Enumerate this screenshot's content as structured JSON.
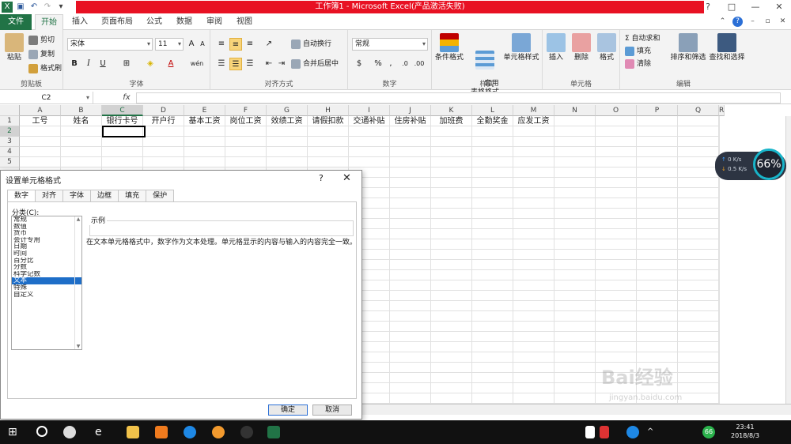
{
  "titlebar": {
    "title": "工作簿1 - Microsoft Excel(产品激活失败)",
    "window_buttons": [
      "?",
      "□",
      "—",
      "✕"
    ]
  },
  "tabs": [
    "文件",
    "开始",
    "插入",
    "页面布局",
    "公式",
    "数据",
    "审阅",
    "视图"
  ],
  "ribbon": {
    "clipboard": {
      "paste": "粘贴",
      "cut": "剪切",
      "copy": "复制",
      "painter": "格式刷",
      "label": "剪贴板"
    },
    "font": {
      "name": "宋体",
      "size": "11",
      "bold": "B",
      "italic": "I",
      "underline": "U",
      "phonetic": "wén",
      "label": "字体"
    },
    "align": {
      "wrap": "自动换行",
      "merge": "合并后居中",
      "label": "对齐方式"
    },
    "number": {
      "format": "常规",
      "percent": "%",
      "comma": ",",
      "label": "数字"
    },
    "styles": {
      "cond": "条件格式",
      "table": "套用\n表格格式",
      "cell": "单元格样式",
      "label": "样式"
    },
    "cells": {
      "insert": "插入",
      "delete": "删除",
      "format": "格式",
      "label": "单元格"
    },
    "edit": {
      "autosum": "Σ 自动求和",
      "fill": "填充",
      "clear": "清除",
      "sort": "排序和筛选",
      "find": "查找和选择",
      "label": "编辑"
    }
  },
  "formulabar": {
    "namebox": "C2",
    "fx": "fx",
    "value": ""
  },
  "grid": {
    "columns": [
      "A",
      "B",
      "C",
      "D",
      "E",
      "F",
      "G",
      "H",
      "I",
      "J",
      "K",
      "L",
      "M",
      "N",
      "O",
      "P",
      "Q",
      "R"
    ],
    "rows": [
      "1",
      "2",
      "3",
      "4",
      "5"
    ],
    "row1": [
      "工号",
      "姓名",
      "银行卡号",
      "开户行",
      "基本工资",
      "岗位工资",
      "效绩工资",
      "请假扣款",
      "交通补贴",
      "住房补贴",
      "加班费",
      "全勤奖金",
      "应发工资"
    ]
  },
  "netwidget": {
    "up": "0 K/s",
    "down": "0.5 K/s",
    "percent": "66%"
  },
  "dialog": {
    "title": "设置单元格格式",
    "help": "?",
    "close": "✕",
    "tabs": [
      "数字",
      "对齐",
      "字体",
      "边框",
      "填充",
      "保护"
    ],
    "category_label": "分类(C):",
    "categories": [
      "常规",
      "数值",
      "货币",
      "会计专用",
      "日期",
      "时间",
      "百分比",
      "分数",
      "科学记数",
      "文本",
      "特殊",
      "自定义"
    ],
    "selected_category": "文本",
    "sample_label": "示例",
    "description": "在文本单元格格式中，数字作为文本处理。单元格显示的内容与输入的内容完全一致。",
    "ok": "确定",
    "cancel": "取消"
  },
  "taskbar": {
    "time": "23:41",
    "date": "2018/8/3",
    "badge": "66"
  },
  "watermark": {
    "text": "Bai经验",
    "sub": "jingyan.baidu.com"
  },
  "colors": {
    "excel_green": "#217346",
    "title_red": "#e81123",
    "selection_blue": "#1e6ec8"
  }
}
